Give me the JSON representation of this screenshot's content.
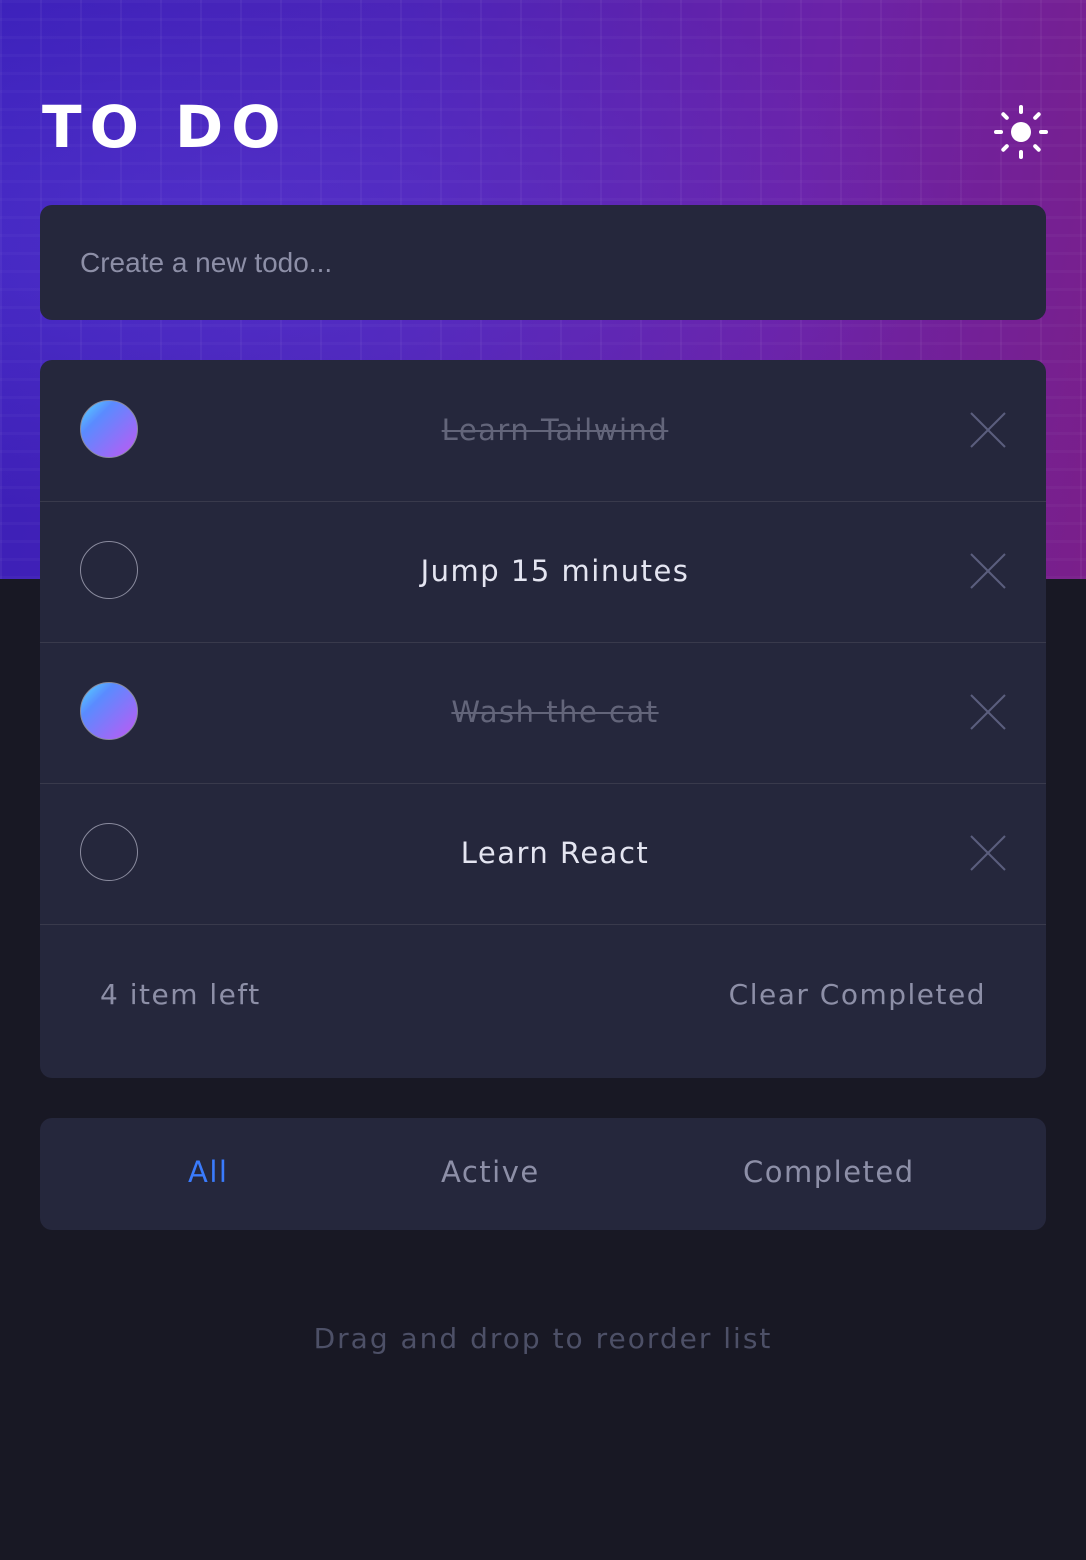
{
  "header": {
    "title": "TO DO",
    "theme_icon": "sun-icon"
  },
  "new_todo": {
    "placeholder": "Create a new todo...",
    "value": ""
  },
  "todos": [
    {
      "text": "Learn Tailwind",
      "completed": true
    },
    {
      "text": "Jump 15 minutes",
      "completed": false
    },
    {
      "text": "Wash the cat",
      "completed": true
    },
    {
      "text": "Learn React",
      "completed": false
    }
  ],
  "footer": {
    "items_left": "4 item left",
    "clear_label": "Clear Completed"
  },
  "filters": {
    "all": "All",
    "active": "Active",
    "completed": "Completed",
    "selected": "All"
  },
  "hint": "Drag and drop to reorder list",
  "colors": {
    "accent": "#3a7bfd",
    "card": "#25273c",
    "background": "#181824",
    "check_gradient_start": "#55ddff",
    "check_gradient_end": "#c058f3"
  }
}
